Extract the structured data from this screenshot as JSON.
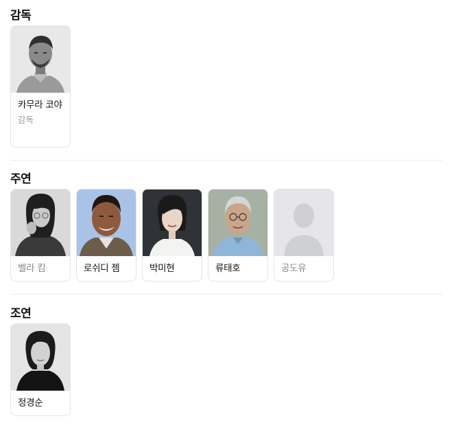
{
  "sections": {
    "director": {
      "title": "감독",
      "people": [
        {
          "name": "카무라 코야",
          "role": "감독",
          "photo_icon": "person-photo-icon"
        }
      ]
    },
    "main_cast": {
      "title": "주연",
      "people": [
        {
          "name": "벨라 킴",
          "photo_icon": "person-photo-icon"
        },
        {
          "name": "로쉬디 젬",
          "photo_icon": "person-photo-icon"
        },
        {
          "name": "박미현",
          "photo_icon": "person-photo-icon"
        },
        {
          "name": "류태호",
          "photo_icon": "person-photo-icon"
        },
        {
          "name": "공도유",
          "photo_icon": "person-placeholder-icon"
        }
      ]
    },
    "supporting_cast": {
      "title": "조연",
      "people": [
        {
          "name": "정경순",
          "photo_icon": "person-photo-icon"
        }
      ]
    }
  },
  "colors": {
    "text_primary": "#111111",
    "text_dim": "#888888",
    "role_text": "#999999",
    "card_border": "#e5e5e5",
    "divider": "#eeeeee",
    "placeholder_bg": "#e6e6e8",
    "placeholder_silhouette": "#cfd0d4"
  }
}
